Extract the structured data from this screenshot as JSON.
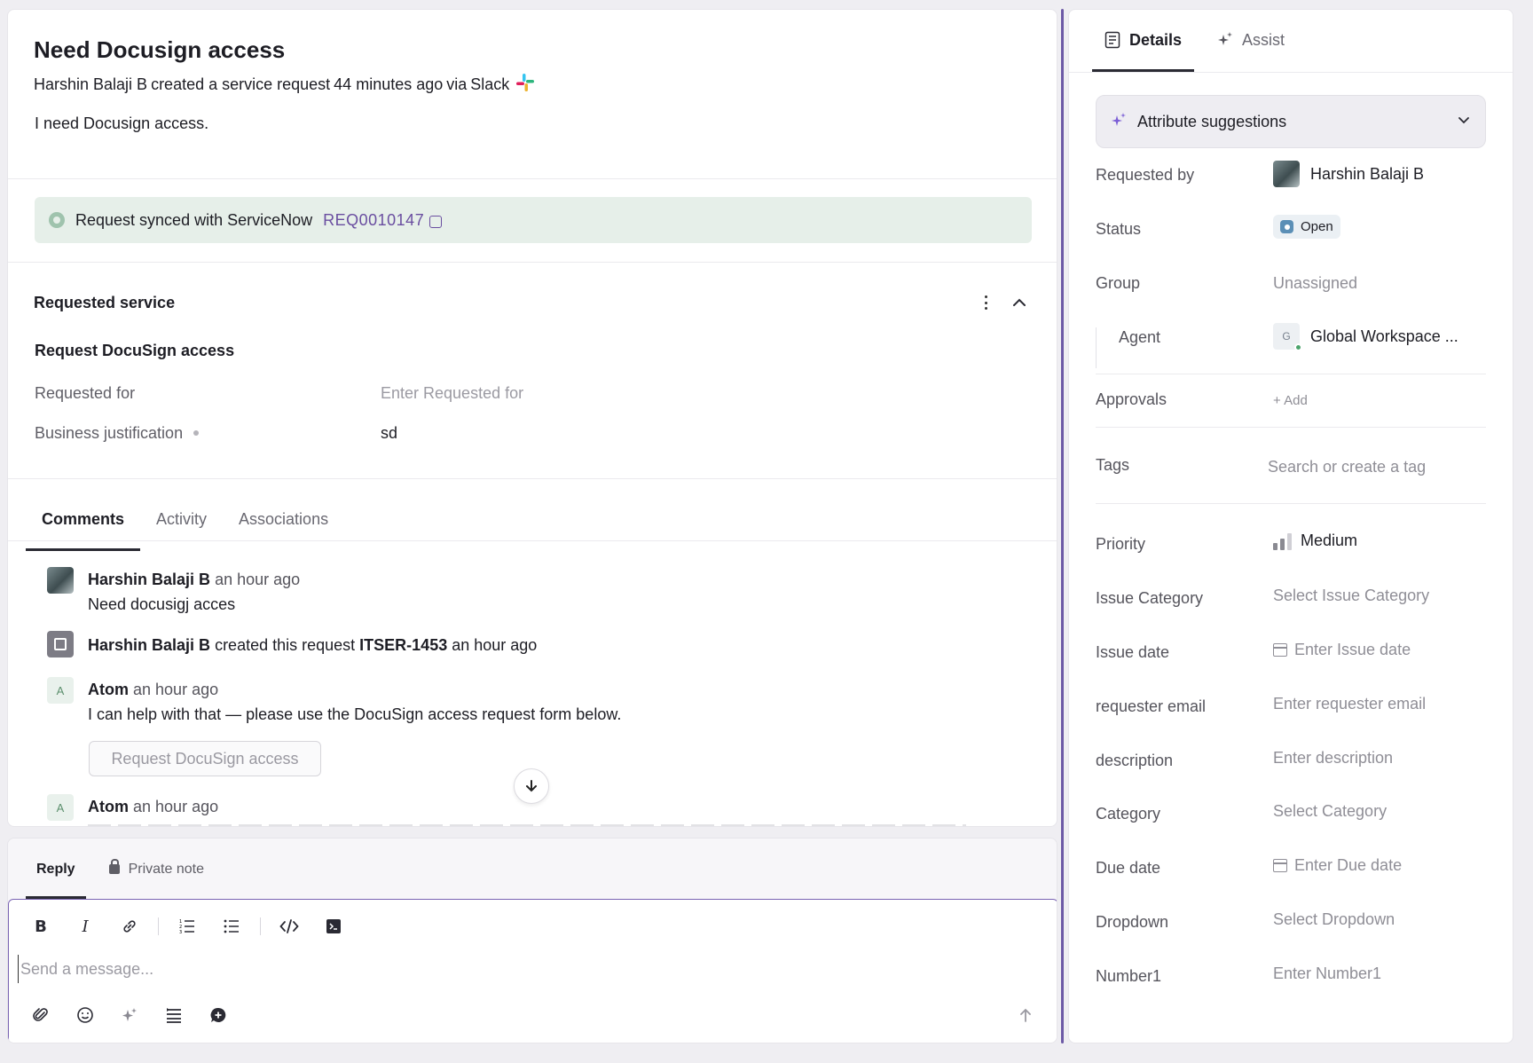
{
  "ticket": {
    "title": "Need Docusign access",
    "creator": "Harshin Balaji B",
    "created_text": "created a service request",
    "time_ago": "44 minutes ago",
    "via_text": "via",
    "channel": "Slack",
    "description": "I need Docusign access."
  },
  "sync": {
    "text": "Request synced with ServiceNow",
    "ref": "REQ0010147"
  },
  "requested_service": {
    "section_title": "Requested service",
    "service_name": "Request DocuSign access",
    "fields": [
      {
        "label": "Requested for",
        "value": "",
        "placeholder": "Enter Requested for"
      },
      {
        "label": "Business justification",
        "value": "sd",
        "placeholder": ""
      }
    ]
  },
  "tabs": [
    "Comments",
    "Activity",
    "Associations"
  ],
  "comments": [
    {
      "author": "Harshin Balaji B",
      "time": "an hour ago",
      "body": "Need docusigj acces"
    },
    {
      "author": "Harshin Balaji B",
      "action": "created this request",
      "ref": "ITSER-1453",
      "time": "an hour ago"
    },
    {
      "author": "Atom",
      "avatar_letter": "A",
      "time": "an hour ago",
      "body": "I can help with that — please use the DocuSign access request form below.",
      "button": "Request DocuSign access"
    },
    {
      "author": "Atom",
      "avatar_letter": "A",
      "time": "an hour ago"
    }
  ],
  "reply": {
    "tabs": [
      "Reply",
      "Private note"
    ],
    "placeholder": "Send a message..."
  },
  "details": {
    "tabs": [
      "Details",
      "Assist"
    ],
    "attribute_suggestions": "Attribute suggestions",
    "rows": {
      "requested_by": {
        "label": "Requested by",
        "value": "Harshin Balaji B"
      },
      "status": {
        "label": "Status",
        "value": "Open"
      },
      "group": {
        "label": "Group",
        "value": "Unassigned"
      },
      "agent": {
        "label": "Agent",
        "value": "Global Workspace ...",
        "avatar_letter": "G"
      },
      "approvals": {
        "label": "Approvals",
        "value": "+  Add"
      },
      "tags": {
        "label": "Tags",
        "value": "Search or create a tag"
      },
      "priority": {
        "label": "Priority",
        "value": "Medium"
      },
      "issue_category": {
        "label": "Issue Category",
        "value": "Select Issue Category"
      },
      "issue_date": {
        "label": "Issue date",
        "value": "Enter Issue date"
      },
      "requester_email": {
        "label": "requester email",
        "value": "Enter requester email"
      },
      "description": {
        "label": "description",
        "value": "Enter description"
      },
      "category": {
        "label": "Category",
        "value": "Select Category"
      },
      "due_date": {
        "label": "Due date",
        "value": "Enter Due date"
      },
      "dropdown": {
        "label": "Dropdown",
        "value": "Select Dropdown"
      },
      "number1": {
        "label": "Number1",
        "value": "Enter Number1"
      }
    }
  },
  "colors": {
    "accent": "#6a4ea0",
    "sync_bg": "#e6efe9",
    "status_open": "#5b8fb6",
    "online": "#4aa36b"
  }
}
